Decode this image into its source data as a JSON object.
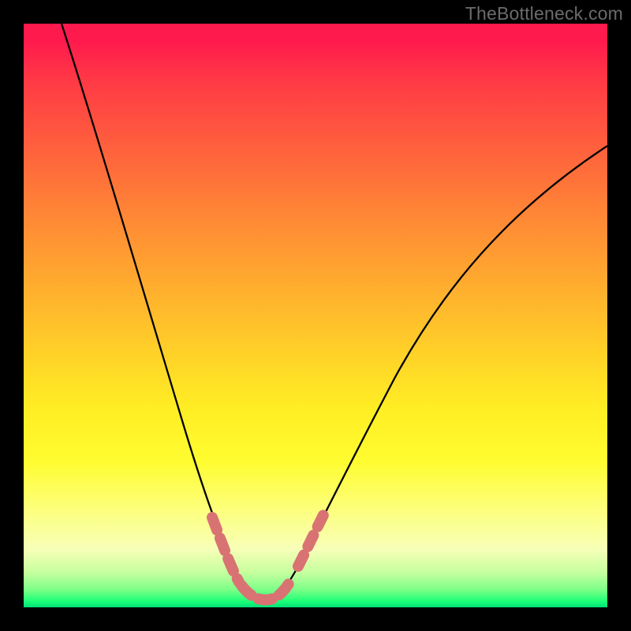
{
  "watermark": "TheBottleneck.com",
  "chart_data": {
    "type": "line",
    "title": "",
    "xlabel": "",
    "ylabel": "",
    "x": [
      0.0,
      0.05,
      0.1,
      0.15,
      0.2,
      0.25,
      0.3,
      0.35,
      0.38,
      0.4,
      0.43,
      0.45,
      0.5,
      0.55,
      0.6,
      0.65,
      0.7,
      0.8,
      0.9,
      1.0
    ],
    "series": [
      {
        "name": "bottleneck-curve",
        "values": [
          1.0,
          0.88,
          0.75,
          0.62,
          0.5,
          0.37,
          0.24,
          0.11,
          0.04,
          0.02,
          0.02,
          0.03,
          0.08,
          0.16,
          0.23,
          0.3,
          0.36,
          0.47,
          0.56,
          0.64
        ]
      }
    ],
    "highlight_segments": [
      {
        "x_start": 0.33,
        "x_end": 0.38,
        "side": "left"
      },
      {
        "x_start": 0.38,
        "x_end": 0.45,
        "side": "bottom"
      },
      {
        "x_start": 0.46,
        "x_end": 0.5,
        "side": "right"
      }
    ],
    "xlim": [
      0,
      1
    ],
    "ylim": [
      0,
      1
    ],
    "annotations": []
  },
  "colors": {
    "curve": "#000000",
    "highlight": "#d97373",
    "gradient_top": "#ff1a4d",
    "gradient_bottom": "#00e079"
  }
}
